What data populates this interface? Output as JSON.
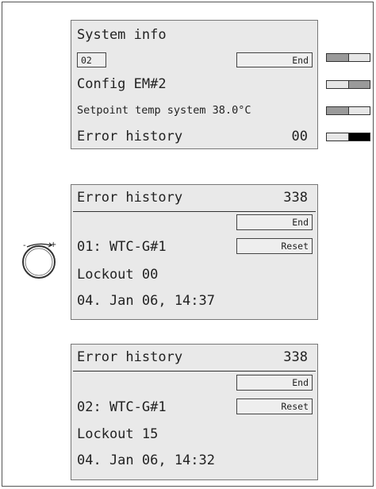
{
  "panel1": {
    "title": "System info",
    "box_left": "02",
    "box_right": "End",
    "line2": "Config EM#2",
    "line3": "Setpoint temp system 38.0°C",
    "line4_label": "Error history",
    "line4_value": "00"
  },
  "panel2": {
    "title": "Error history",
    "count": "338",
    "end_button": "End",
    "reset_button": "Reset",
    "entry": "01: WTC-G#1",
    "lockout": "Lockout 00",
    "datetime": "04. Jan 06, 14:37"
  },
  "panel3": {
    "title": "Error history",
    "count": "338",
    "end_button": "End",
    "reset_button": "Reset",
    "entry": "02: WTC-G#1",
    "lockout": "Lockout 15",
    "datetime": "04. Jan 06, 14:32"
  },
  "indicators": [
    {
      "name": "indicator-1",
      "active_cell": 1
    },
    {
      "name": "indicator-2",
      "active_cell": 2
    },
    {
      "name": "indicator-3",
      "active_cell": 1
    },
    {
      "name": "indicator-4",
      "active_cell": 2
    }
  ],
  "knob": {
    "icon": "rotary-knob-icon",
    "minus_sign": "-",
    "plus_sign": "+"
  },
  "colors": {
    "panel_bg": "#e9e9e9",
    "indicator_light": "#e6e6e6",
    "indicator_mid": "#9a9a9a",
    "indicator_dark": "#000000"
  }
}
